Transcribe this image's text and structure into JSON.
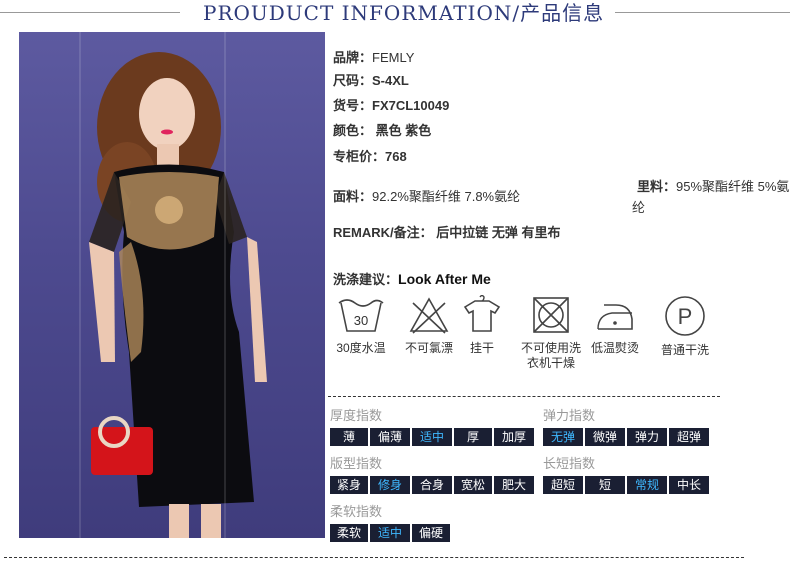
{
  "header": {
    "title": "PROUDUCT INFORMATION/产品信息"
  },
  "specs": [
    {
      "label": "品牌：",
      "value": "FEMLY",
      "bold": false
    },
    {
      "label": "尺码：",
      "value": "S-4XL",
      "bold": true
    },
    {
      "label": "货号：",
      "value": "FX7CL10049",
      "bold": true
    },
    {
      "label": "颜色：",
      "value": " 黑色 紫色",
      "bold": true
    },
    {
      "label": "专柜价：",
      "value": "768",
      "bold": true
    }
  ],
  "fabric": {
    "label": "面料：",
    "value": "92.2%聚酯纤维 7.8%氨纶"
  },
  "lining": {
    "label": "里料：",
    "value": "95%聚酯纤维 5%氨纶"
  },
  "remark": {
    "label": "REMARK/备注：",
    "value": " 后中拉链 无弹 有里布"
  },
  "wash": {
    "label": "洗涤建议：",
    "value": "Look After Me"
  },
  "care_icons": [
    {
      "icon": "wash-30-icon",
      "label": "30度水温",
      "number": "30"
    },
    {
      "icon": "no-bleach-icon",
      "label": "不可氯漂"
    },
    {
      "icon": "hang-dry-icon",
      "label": "挂干"
    },
    {
      "icon": "no-tumble-dry-icon",
      "label": "不可使用洗衣机干燥"
    },
    {
      "icon": "low-iron-icon",
      "label": "低温熨烫"
    },
    {
      "icon": "dry-clean-p-icon",
      "label": "普通干洗",
      "letter": "P"
    }
  ],
  "indices": {
    "thickness": {
      "title": "厚度指数",
      "options": [
        "薄",
        "偏薄",
        "适中",
        "厚",
        "加厚"
      ],
      "selected": "适中"
    },
    "elasticity": {
      "title": "弹力指数",
      "options": [
        "无弹",
        "微弹",
        "弹力",
        "超弹"
      ],
      "selected": "无弹"
    },
    "fit": {
      "title": "版型指数",
      "options": [
        "紧身",
        "修身",
        "合身",
        "宽松",
        "肥大"
      ],
      "selected": "修身"
    },
    "length": {
      "title": "长短指数",
      "options": [
        "超短",
        "短",
        "常规",
        "中长"
      ],
      "selected": "常规"
    },
    "softness": {
      "title": "柔软指数",
      "options": [
        "柔软",
        "适中",
        "偏硬"
      ],
      "selected": "适中"
    }
  },
  "colors": {
    "header": "#2d3a7a",
    "cell_bg": "#1a1f33",
    "cell_selected_text": "#3fb8ff"
  }
}
